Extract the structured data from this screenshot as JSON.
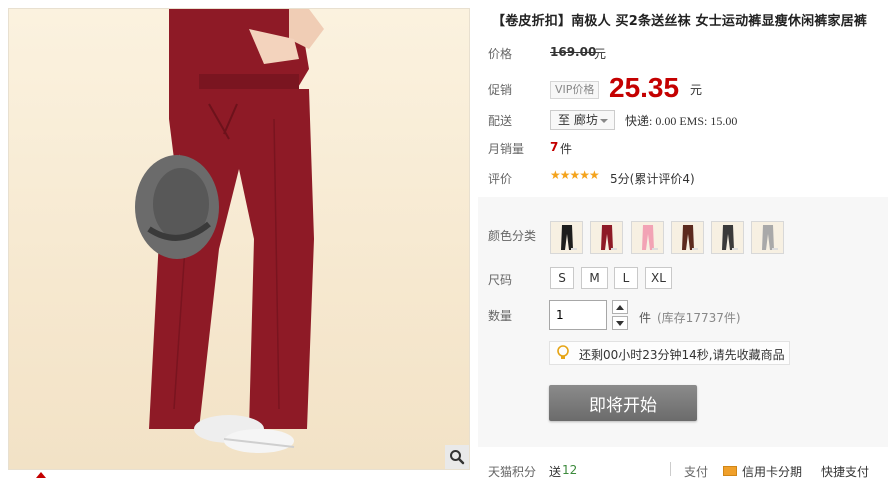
{
  "product": {
    "title": "【卷皮折扣】南极人 买2条送丝袜 女士运动裤显瘦休闲裤家居裤"
  },
  "price_row": {
    "label": "价格",
    "original_price": "169.00",
    "unit": "元"
  },
  "promo_row": {
    "label": "促销",
    "tag": "VIP价格",
    "price": "25.35",
    "unit": "元"
  },
  "shipping_row": {
    "label": "配送",
    "destination": "至 廊坊",
    "info": "快递: 0.00 EMS: 15.00"
  },
  "sales_row": {
    "label": "月销量",
    "count": "7",
    "unit": "件"
  },
  "rating_row": {
    "label": "评价",
    "stars": "★★★★★",
    "text": "5分(累计评价4)"
  },
  "sku": {
    "color_label": "颜色分类",
    "size_label": "尺码",
    "sizes": [
      "S",
      "M",
      "L",
      "XL"
    ],
    "quantity_label": "数量",
    "quantity_value": "1",
    "stock_unit": "件",
    "stock_text": "(库存17737件)"
  },
  "tip": {
    "text": "还剩00小时23分钟14秒,请先收藏商品"
  },
  "action": {
    "start_button": "即将开始"
  },
  "footer": {
    "points_label": "天猫积分",
    "points_prefix": "送",
    "points_value": "12",
    "pay_label": "支付",
    "credit_label": "信用卡分期",
    "quick_label": "快捷支付"
  },
  "colors": {
    "accent_red": "#c40000",
    "star_color": "#f4a31c",
    "pants_colors": [
      "#1d1d1d",
      "#8e1a26",
      "#f2a3b5",
      "#5c2a1e",
      "#3a3a3a",
      "#a9a9a9"
    ]
  },
  "icons": {
    "zoom": "magnifier-icon",
    "tip": "lightbulb-icon",
    "credit": "credit-card-icon"
  }
}
